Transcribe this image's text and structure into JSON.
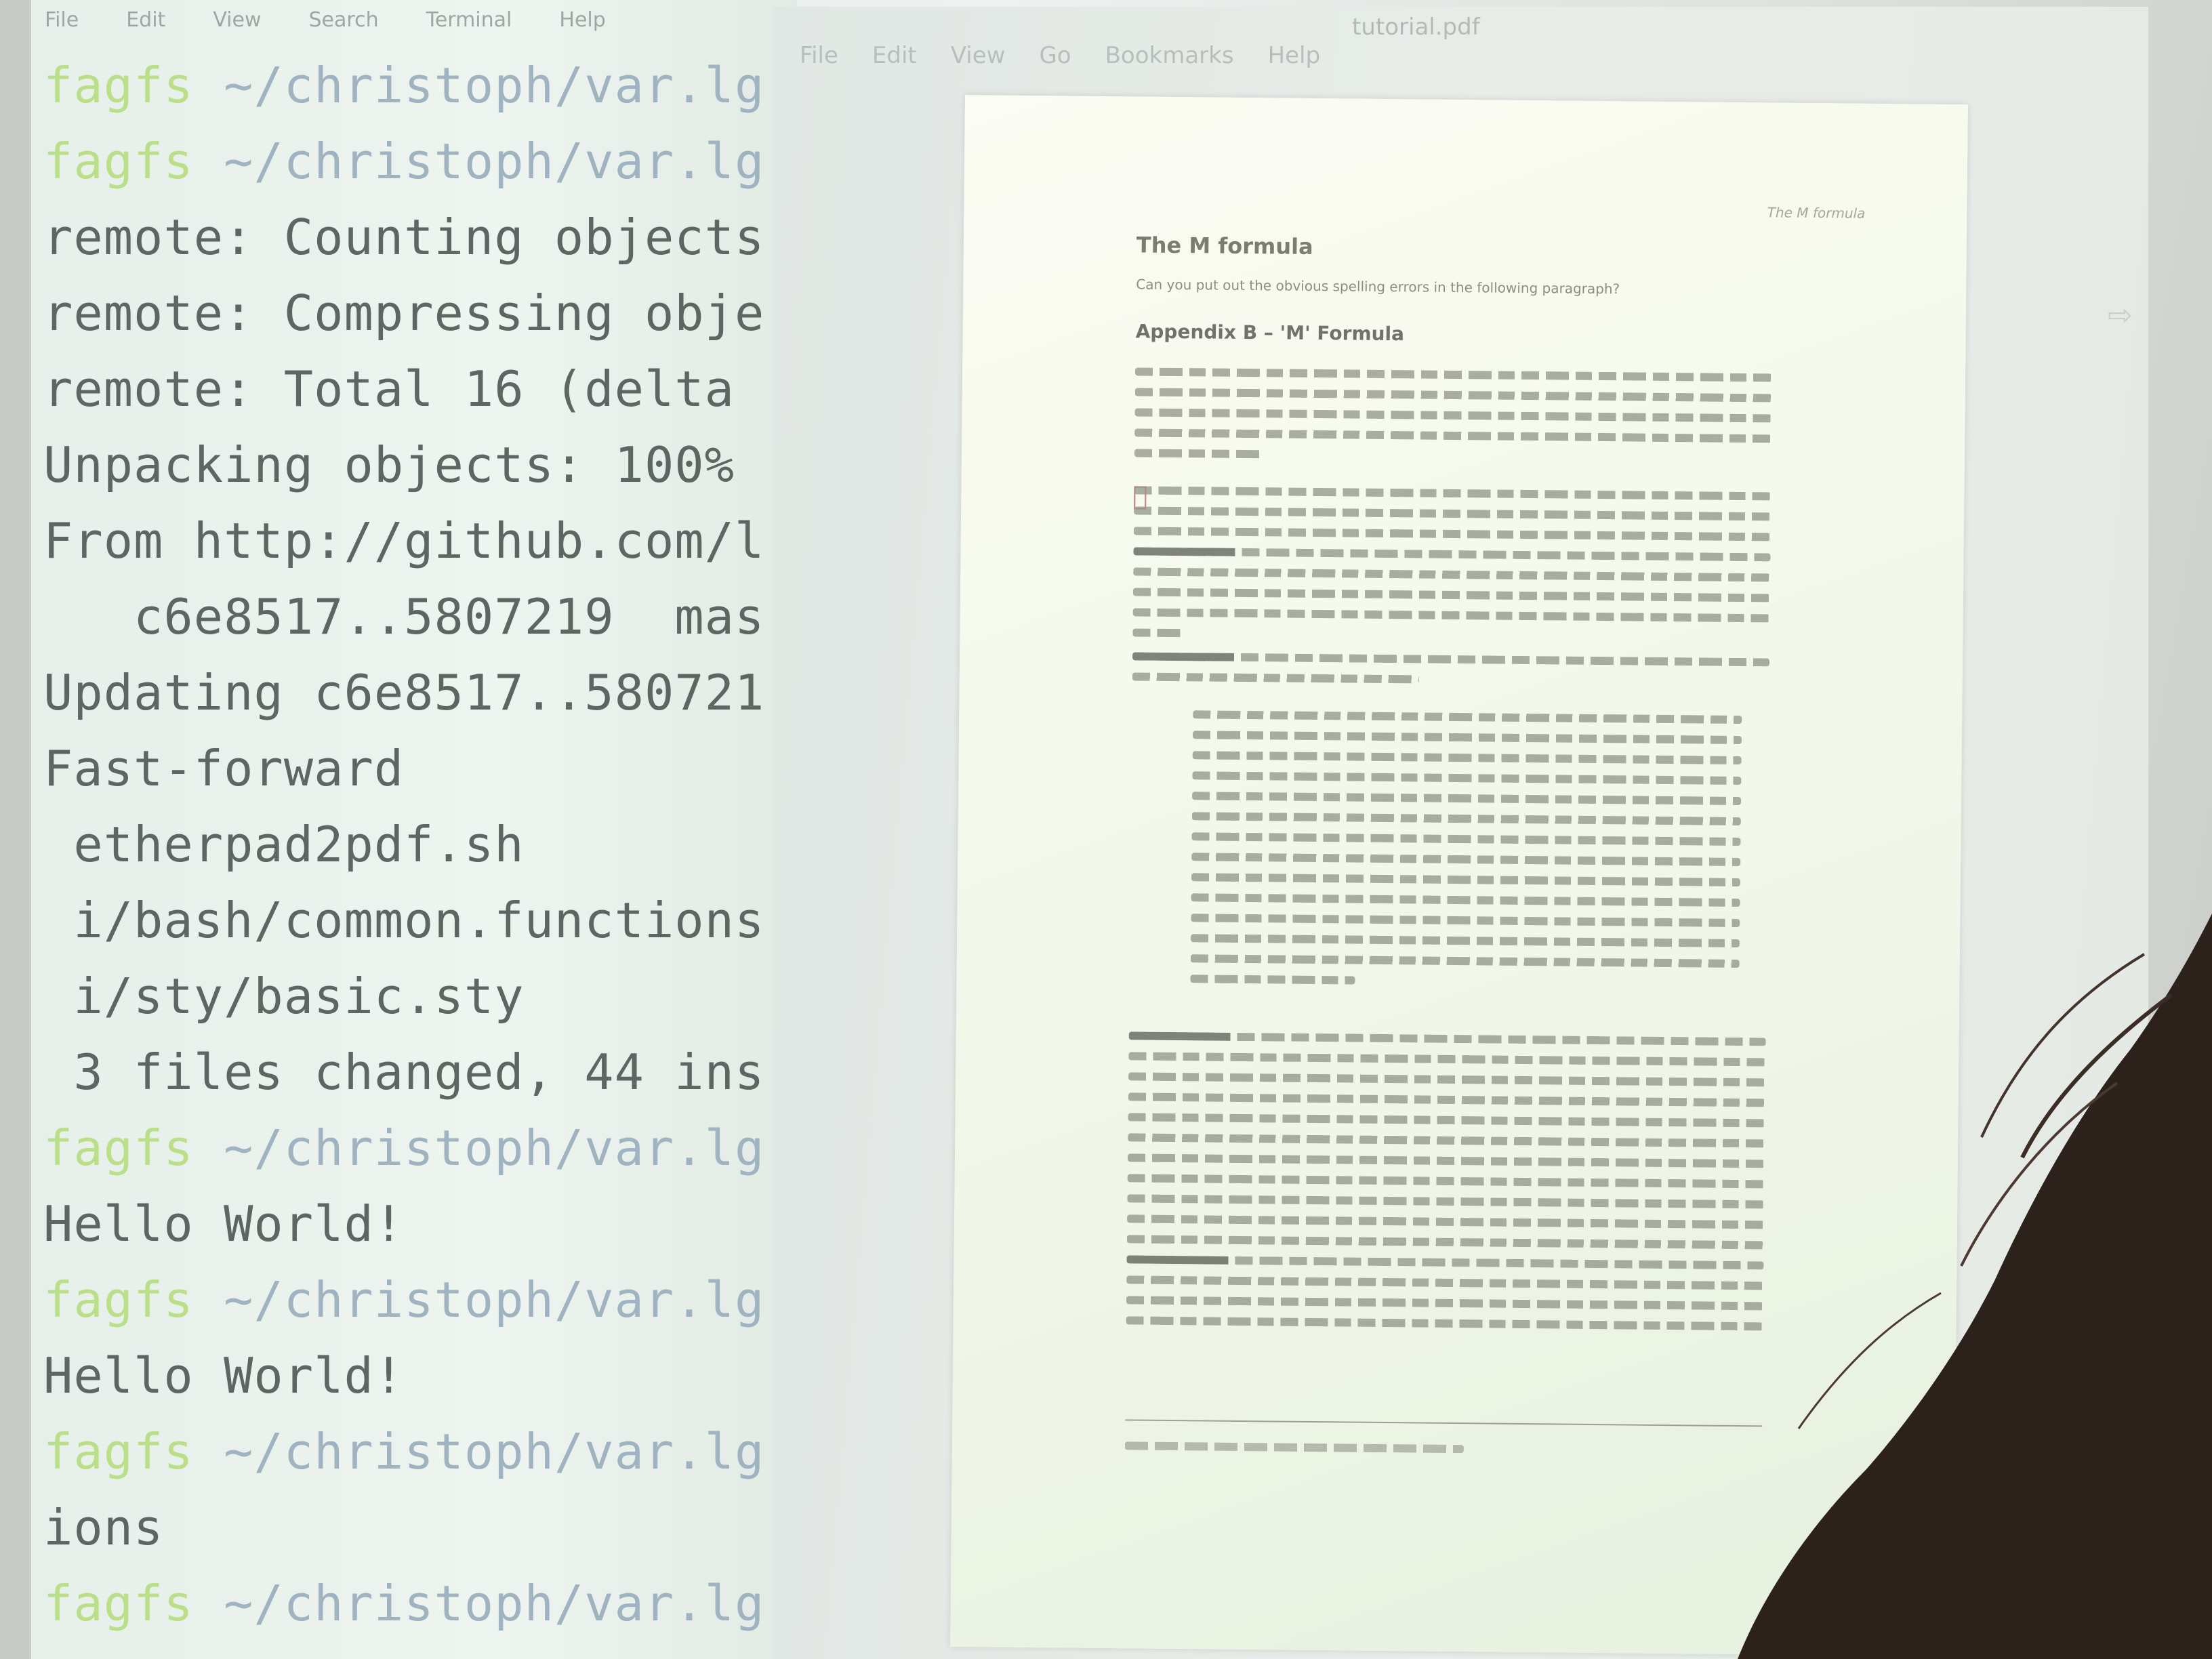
{
  "terminal": {
    "menu": [
      "File",
      "Edit",
      "View",
      "Search",
      "Terminal",
      "Help"
    ],
    "lines": [
      {
        "user": "fagfs",
        "path": "~/christoph/var.lg"
      },
      {
        "user": "fagfs",
        "path": "~/christoph/var.lg"
      },
      {
        "text": "remote: Counting objects"
      },
      {
        "text": "remote: Compressing obje"
      },
      {
        "text": "remote: Total 16 (delta"
      },
      {
        "text": "Unpacking objects: 100%"
      },
      {
        "text": "From http://github.com/l"
      },
      {
        "text": "   c6e8517..5807219  mas"
      },
      {
        "text": "Updating c6e8517..580721"
      },
      {
        "text": "Fast-forward"
      },
      {
        "text": " etherpad2pdf.sh"
      },
      {
        "text": " i/bash/common.functions"
      },
      {
        "text": " i/sty/basic.sty"
      },
      {
        "text": " 3 files changed, 44 ins"
      },
      {
        "user": "fagfs",
        "path": "~/christoph/var.lg"
      },
      {
        "text": "Hello World!"
      },
      {
        "user": "fagfs",
        "path": "~/christoph/var.lg"
      },
      {
        "text": "Hello World!"
      },
      {
        "user": "fagfs",
        "path": "~/christoph/var.lg"
      },
      {
        "text": "ions"
      },
      {
        "user": "fagfs",
        "path": "~/christoph/var.lg"
      }
    ]
  },
  "viewer": {
    "title": "tutorial.pdf",
    "menu": [
      "File",
      "Edit",
      "View",
      "Go",
      "Bookmarks",
      "Help"
    ],
    "page": {
      "running_head": "The M formula",
      "title": "The M formula",
      "prompt": "Can you put out the obvious spelling errors in the following paragraph?",
      "appendix_heading": "Appendix B – 'M' Formula"
    }
  }
}
